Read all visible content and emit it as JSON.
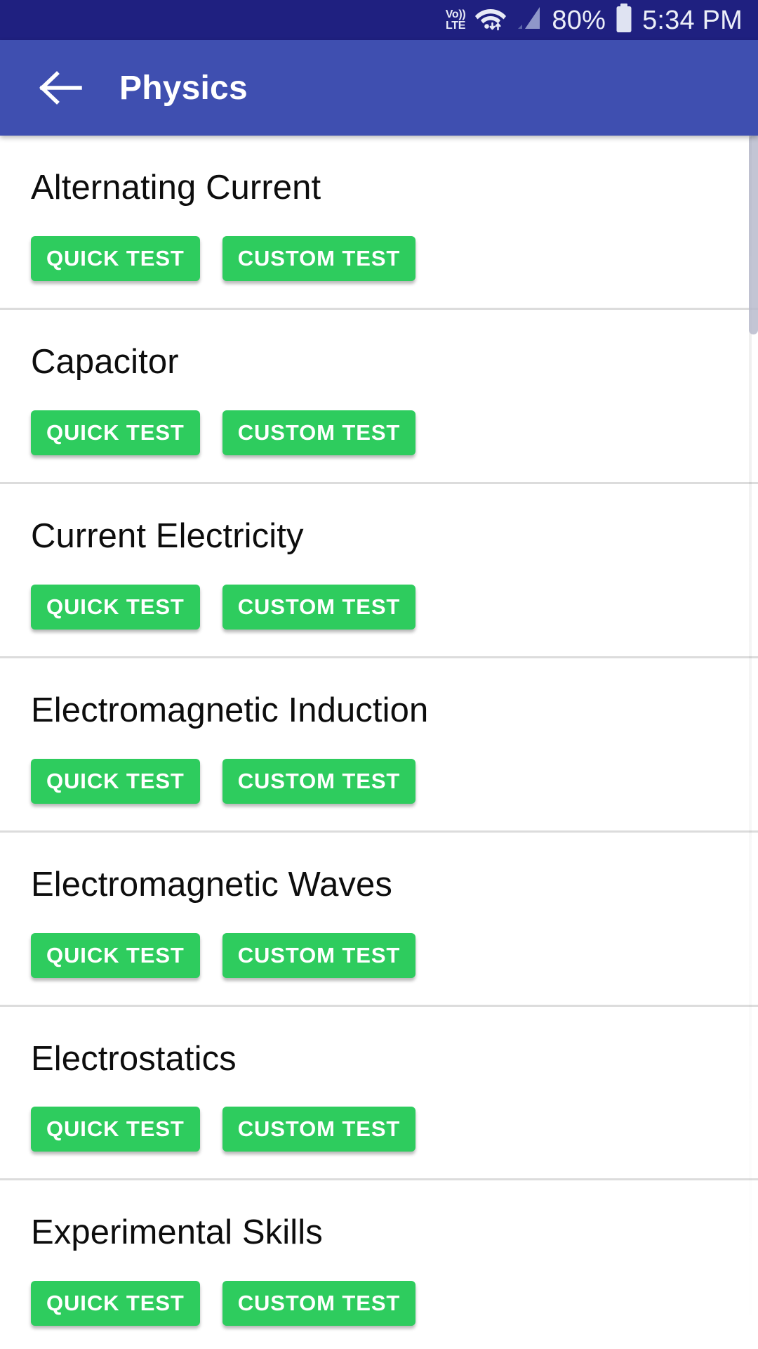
{
  "status_bar": {
    "volte_top": "Vo))",
    "volte_bottom": "LTE",
    "battery_percent": "80%",
    "time": "5:34 PM",
    "background_color": "#1f2080",
    "icons": [
      "volte-icon",
      "wifi-icon",
      "signal-icon",
      "battery-icon"
    ]
  },
  "app_bar": {
    "title": "Physics",
    "back_icon": "arrow-back-icon",
    "background_color": "#3f4fb0",
    "text_color": "#ffffff"
  },
  "buttons": {
    "quick_test": "QUICK TEST",
    "custom_test": "CUSTOM TEST",
    "color": "#2ecc5e",
    "text_color": "#ffffff"
  },
  "list": {
    "items": [
      {
        "title": "Alternating Current"
      },
      {
        "title": "Capacitor"
      },
      {
        "title": "Current Electricity"
      },
      {
        "title": "Electromagnetic Induction"
      },
      {
        "title": "Electromagnetic Waves"
      },
      {
        "title": "Electrostatics"
      },
      {
        "title": "Experimental Skills"
      }
    ]
  },
  "scrollbar": {
    "visible": true,
    "thumb_color": "#b9bbcc"
  }
}
